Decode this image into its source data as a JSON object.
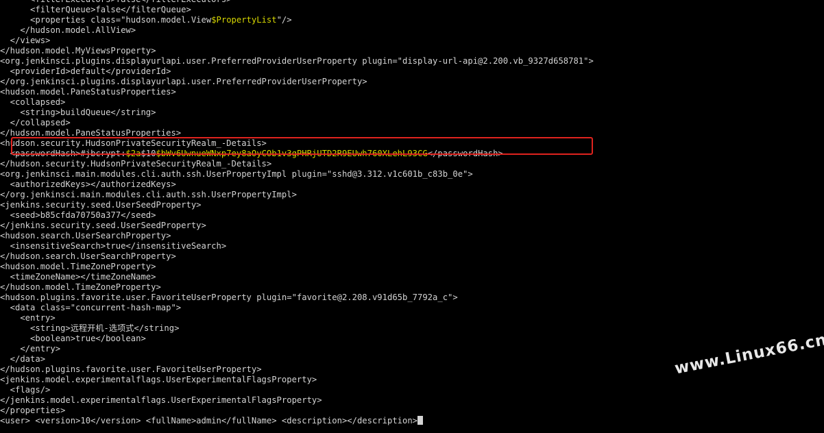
{
  "terminal": {
    "lines": [
      "      <filterExecutors>false</filterExecutors>",
      "      <filterQueue>false</filterQueue>",
      "      <properties class=\"hudson.model.View$PropertyList\"/>",
      "    </hudson.model.AllView>",
      "  </views>",
      "</hudson.model.MyViewsProperty>",
      "<org.jenkinsci.plugins.displayurlapi.user.PreferredProviderUserProperty plugin=\"display-url-api@2.200.vb_9327d658781\">",
      "  <providerId>default</providerId>",
      "</org.jenkinsci.plugins.displayurlapi.user.PreferredProviderUserProperty>",
      "<hudson.model.PaneStatusProperties>",
      "  <collapsed>",
      "    <string>buildQueue</string>",
      "  </collapsed>",
      "</hudson.model.PaneStatusProperties>",
      "<hudson.security.HudsonPrivateSecurityRealm_-Details>",
      "  <passwordHash>#jbcrypt:$2a$10$bWv6UwnueWNxp7ey8aOyCOb1v3gPHRjUTD2R9EUwh760XLehL93CG</passwordHash>",
      "</hudson.security.HudsonPrivateSecurityRealm_-Details>",
      "<org.jenkinsci.main.modules.cli.auth.ssh.UserPropertyImpl plugin=\"sshd@3.312.v1c601b_c83b_0e\">",
      "  <authorizedKeys></authorizedKeys>",
      "</org.jenkinsci.main.modules.cli.auth.ssh.UserPropertyImpl>",
      "<jenkins.security.seed.UserSeedProperty>",
      "  <seed>b85cfda70750a377</seed>",
      "</jenkins.security.seed.UserSeedProperty>",
      "<hudson.search.UserSearchProperty>",
      "  <insensitiveSearch>true</insensitiveSearch>",
      "</hudson.search.UserSearchProperty>",
      "<hudson.model.TimeZoneProperty>",
      "  <timeZoneName></timeZoneName>",
      "</hudson.model.TimeZoneProperty>",
      "<hudson.plugins.favorite.user.FavoriteUserProperty plugin=\"favorite@2.208.v91d65b_7792a_c\">",
      "  <data class=\"concurrent-hash-map\">",
      "    <entry>",
      "      <string>远程开机-选项式</string>",
      "      <boolean>true</boolean>",
      "    </entry>",
      "  </data>",
      "</hudson.plugins.favorite.user.FavoriteUserProperty>",
      "<jenkins.model.experimentalflags.UserExperimentalFlagsProperty>",
      "  <flags/>",
      "</jenkins.model.experimentalflags.UserExperimentalFlagsProperty>",
      "</properties>",
      "<user> <version>10</version> <fullName>admin</fullName> <description></description>"
    ],
    "highlights": [
      {
        "line": 2,
        "text": "$PropertyList"
      },
      {
        "line": 15,
        "text": "$2a"
      },
      {
        "line": 15,
        "text": "$bWv6UwnueWNxp7ey8aOyCOb1v3gPHRjUTD2R9EUwh760XLehL93CG"
      }
    ],
    "highlight_color": "#d7d700",
    "text_color": "#d4d4d4",
    "box_color": "#e0231e"
  },
  "watermark": {
    "text": "www.Linux66.cn"
  }
}
